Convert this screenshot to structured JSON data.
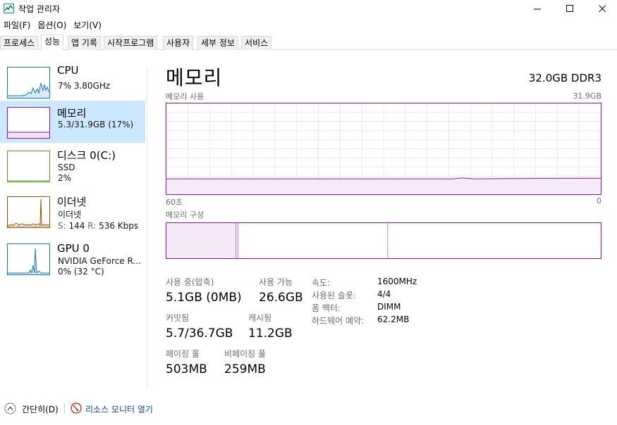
{
  "window": {
    "title": "작업 관리자"
  },
  "menu": [
    "파일(F)",
    "옵션(O)",
    "보기(V)"
  ],
  "tabs": [
    {
      "label": "프로세스",
      "active": false
    },
    {
      "label": "성능",
      "active": true
    },
    {
      "label": "앱 기록",
      "active": false
    },
    {
      "label": "시작프로그램",
      "active": false
    },
    {
      "label": "사용자",
      "active": false
    },
    {
      "label": "세부 정보",
      "active": false
    },
    {
      "label": "서비스",
      "active": false
    }
  ],
  "sidebar": {
    "items": [
      {
        "title": "CPU",
        "line1": "7% 3.80GHz",
        "line2": "",
        "color": "#117dbb"
      },
      {
        "title": "메모리",
        "line1": "5.3/31.9GB (17%)",
        "line2": "",
        "color": "#8b12ae"
      },
      {
        "title": "디스크 0(C:)",
        "line1": "SSD",
        "line2": "2%",
        "color": "#4da60c"
      },
      {
        "title": "이더넷",
        "line1": "이더넷",
        "line2": "",
        "color": "#a74f01",
        "send_label": "S:",
        "send_value": "144",
        "recv_label": "R:",
        "recv_value": "536 Kbps"
      },
      {
        "title": "GPU 0",
        "line1": "NVIDIA GeForce R...",
        "line2": "0% (32 °C)",
        "color": "#117dbb"
      }
    ]
  },
  "main": {
    "title": "메모리",
    "spec": "32.0GB DDR3",
    "usage_label": "메모리 사용",
    "usage_max": "31.9GB",
    "time_left": "60초",
    "time_right": "0",
    "composition_label": "메모리 구성",
    "in_use_fraction": 0.17,
    "composition_fractions": {
      "in_use": 0.16,
      "modified": 0.005,
      "standby": 0.345,
      "free": 0.49
    },
    "stats": {
      "in_use_label": "사용 중(압축)",
      "in_use_value": "5.1GB (0MB)",
      "available_label": "사용 가능",
      "available_value": "26.6GB",
      "committed_label": "커밋됨",
      "committed_value": "5.7/36.7GB",
      "cached_label": "캐시됨",
      "cached_value": "11.2GB",
      "paged_label": "페이징 풀",
      "paged_value": "503MB",
      "nonpaged_label": "비페이징 풀",
      "nonpaged_value": "259MB"
    },
    "info": [
      {
        "key": "속도:",
        "value": "1600MHz"
      },
      {
        "key": "사용된 슬롯:",
        "value": "4/4"
      },
      {
        "key": "폼 팩터:",
        "value": "DIMM"
      },
      {
        "key": "하드웨어 예약:",
        "value": "62.2MB"
      }
    ]
  },
  "footer": {
    "fewer_details": "간단히(D)",
    "resource_monitor": "리소스 모니터 열기"
  },
  "colors": {
    "memory": "#8b12ae",
    "cpu": "#117dbb",
    "disk": "#4da60c",
    "ethernet": "#a74f01",
    "selected": "#cce8ff",
    "link": "#0645ad"
  }
}
